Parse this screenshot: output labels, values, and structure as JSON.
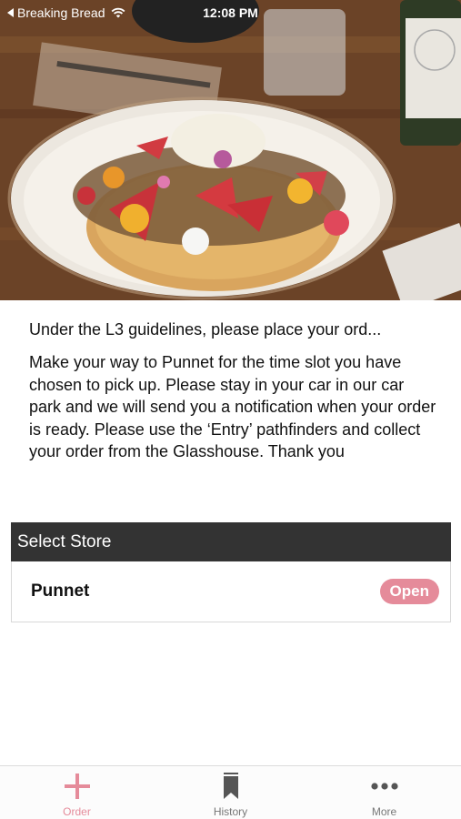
{
  "status_bar": {
    "back_label": "Breaking Bread",
    "time": "12:08 PM"
  },
  "intro": {
    "title": "Under the L3 guidelines, please place your ord...",
    "body": "Make your way to Punnet for the time slot you have chosen to pick up. Please stay in your car in our car park and we will send you a notification when your order is ready. Please use the ‘Entry’ pathfinders and collect your order from the Glasshouse. Thank you"
  },
  "store_section": {
    "header": "Select Store",
    "stores": [
      {
        "name": "Punnet",
        "status": "Open"
      }
    ]
  },
  "tab_bar": {
    "tabs": [
      {
        "label": "Order",
        "icon": "plus-icon",
        "active": true
      },
      {
        "label": "History",
        "icon": "bookmark-icon",
        "active": false
      },
      {
        "label": "More",
        "icon": "more-icon",
        "active": false
      }
    ]
  },
  "colors": {
    "accent": "#e58b9a",
    "header_bg": "#333333"
  }
}
